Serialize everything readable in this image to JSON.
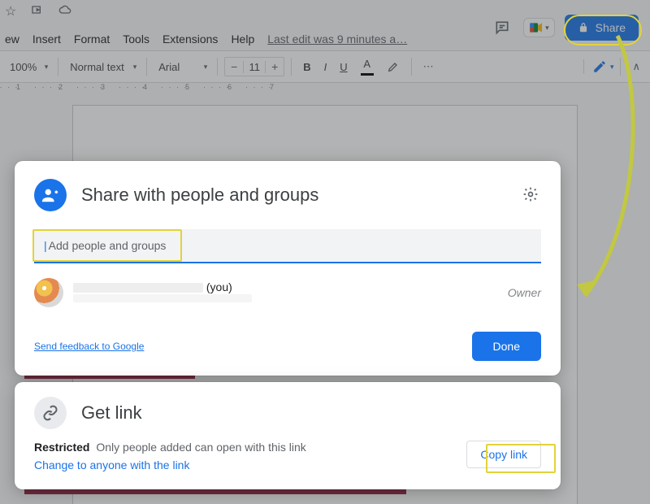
{
  "header": {
    "share_label": "Share",
    "last_edit": "Last edit was 9 minutes a…"
  },
  "menu": {
    "items": [
      "ew",
      "Insert",
      "Format",
      "Tools",
      "Extensions",
      "Help"
    ]
  },
  "toolbar": {
    "zoom": "100%",
    "style": "Normal text",
    "font": "Arial",
    "font_size": "11",
    "bold": "B",
    "italic": "I",
    "underline": "U",
    "text_color_letter": "A",
    "more": "⋯"
  },
  "ruler": {
    "marks": [
      "1",
      "2",
      "3",
      "4",
      "5",
      "6",
      "7"
    ]
  },
  "share_dialog": {
    "title": "Share with people and groups",
    "input_placeholder": "Add people and groups",
    "user": {
      "name_hidden": "",
      "you_suffix": "(you)",
      "email_hidden": "",
      "role": "Owner"
    },
    "feedback": "Send feedback to Google",
    "done": "Done"
  },
  "getlink": {
    "title": "Get link",
    "restricted_label": "Restricted",
    "restricted_desc": "Only people added can open with this link",
    "change": "Change to anyone with the link",
    "copy": "Copy link"
  }
}
